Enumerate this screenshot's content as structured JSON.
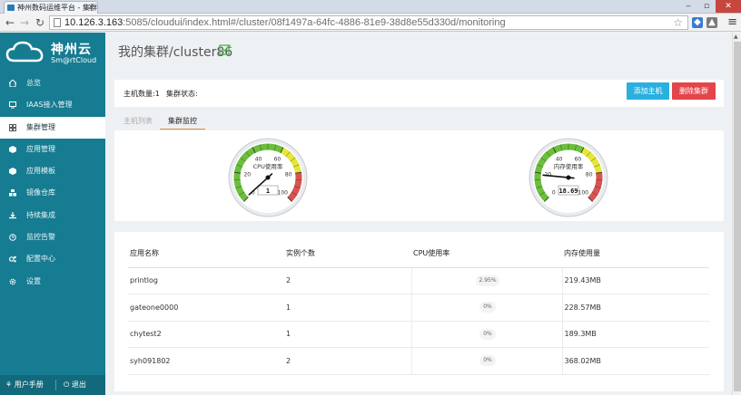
{
  "browser": {
    "tab_title": "神州数码运维平台 - 集群",
    "url_host": "10.126.3.163",
    "url_rest": ":5085/cloudui/index.html#/cluster/08f1497a-64fc-4886-81e9-38d8e55d330d/monitoring"
  },
  "sidebar": {
    "logo_title": "神州云",
    "logo_sub": "Sm@rtCloud",
    "items": [
      {
        "label": "总览",
        "icon": "home-icon"
      },
      {
        "label": "IAAS接入管理",
        "icon": "monitor-icon"
      },
      {
        "label": "集群管理",
        "icon": "grid-icon",
        "active": true
      },
      {
        "label": "应用管理",
        "icon": "app-icon"
      },
      {
        "label": "应用模板",
        "icon": "template-icon"
      },
      {
        "label": "镜像仓库",
        "icon": "cubes-icon"
      },
      {
        "label": "持续集成",
        "icon": "download-icon"
      },
      {
        "label": "监控告警",
        "icon": "alarm-icon"
      },
      {
        "label": "配置中心",
        "icon": "cogs-icon"
      },
      {
        "label": "设置",
        "icon": "gear-icon"
      }
    ],
    "manual_label": "用户手册",
    "exit_label": "退出"
  },
  "page": {
    "title": "我的集群/cluster86",
    "host_count_label": "主机数量:1",
    "cluster_status_label": "集群状态:",
    "add_host_label": "添加主机",
    "delete_cluster_label": "删除集群",
    "tabs": [
      "主机列表",
      "集群监控"
    ]
  },
  "gauges": [
    {
      "name": "cpu",
      "title": "CPU使用率",
      "value": 1,
      "value_label": "1",
      "ticks": [
        "0",
        "20",
        "40",
        "60",
        "80",
        "100"
      ]
    },
    {
      "name": "memory",
      "title": "内存使用率",
      "value": 18.69,
      "value_label": "18.69",
      "ticks": [
        "0",
        "20",
        "40",
        "60",
        "80",
        "100"
      ]
    }
  ],
  "table": {
    "headers": [
      "应用名称",
      "实例个数",
      "CPU使用率",
      "内存使用量"
    ],
    "rows": [
      {
        "name": "printlog",
        "instances": "2",
        "cpu": "2.95%",
        "memory": "219.43MB"
      },
      {
        "name": "gateone0000",
        "instances": "1",
        "cpu": "0%",
        "memory": "228.57MB"
      },
      {
        "name": "chytest2",
        "instances": "1",
        "cpu": "0%",
        "memory": "189.3MB"
      },
      {
        "name": "syh091802",
        "instances": "2",
        "cpu": "0%",
        "memory": "368.02MB"
      }
    ]
  },
  "colors": {
    "sidebar": "#167c91",
    "add_button": "#2ab0df",
    "delete_button": "#e4454a",
    "tab_underline": "#e8833a",
    "gauge_green": "#6bbf3a",
    "gauge_yellow": "#e6e63a",
    "gauge_red": "#d9534f"
  }
}
